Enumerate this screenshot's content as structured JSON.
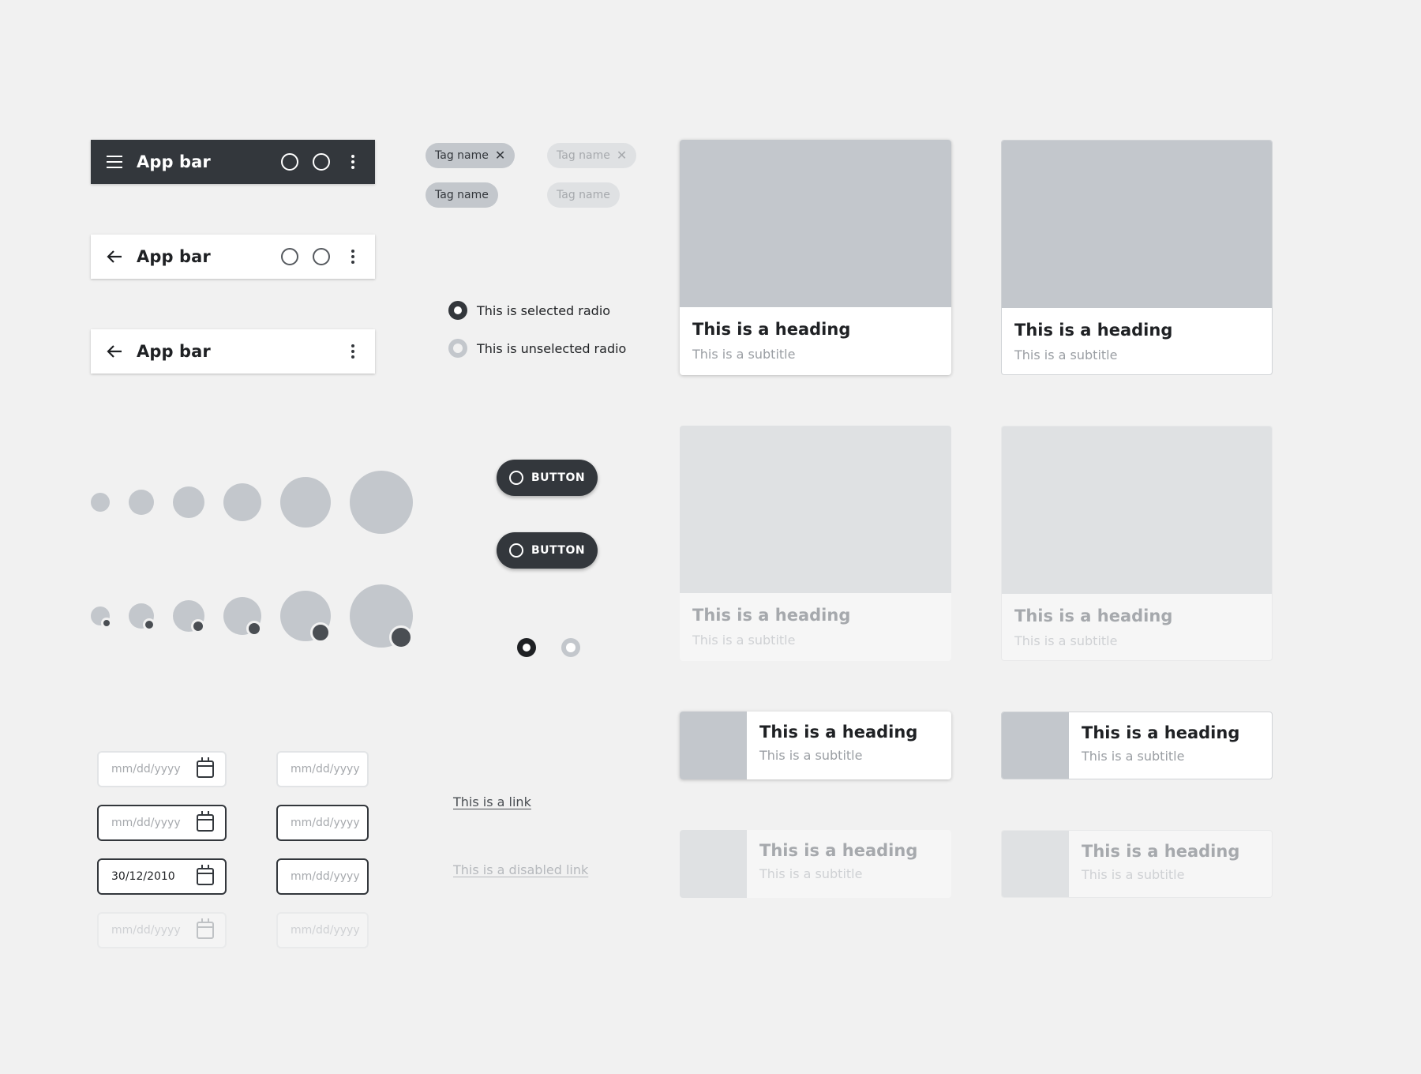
{
  "app_bars": [
    {
      "variant": "dark",
      "leading_icon": "menu-icon",
      "title": "App bar",
      "actions": [
        "circle-icon",
        "circle-icon",
        "more-vert-icon"
      ]
    },
    {
      "variant": "light",
      "leading_icon": "arrow-back-icon",
      "title": "App bar",
      "actions": [
        "circle-icon",
        "circle-icon",
        "more-vert-icon"
      ]
    },
    {
      "variant": "light",
      "leading_icon": "arrow-back-icon",
      "title": "App bar",
      "actions": [
        "more-vert-icon"
      ]
    }
  ],
  "tags": [
    {
      "label": "Tag name",
      "removable": true,
      "state": "enabled"
    },
    {
      "label": "Tag name",
      "removable": true,
      "state": "disabled"
    },
    {
      "label": "Tag name",
      "removable": false,
      "state": "enabled"
    },
    {
      "label": "Tag name",
      "removable": false,
      "state": "disabled"
    }
  ],
  "radios": [
    {
      "label": "This is selected radio",
      "selected": true
    },
    {
      "label": "This is unselected radio",
      "selected": false
    }
  ],
  "buttons": [
    {
      "label": "BUTTON",
      "icon": "circle-icon"
    },
    {
      "label": "BUTTON",
      "icon": "circle-icon"
    }
  ],
  "pagination": {
    "count": 2,
    "active_index": 0
  },
  "date_fields": {
    "placeholder": "mm/dd/yyyy",
    "filled_value": "30/12/2010",
    "icon": "calendar-icon",
    "rows": [
      "default",
      "focused",
      "filled",
      "disabled"
    ]
  },
  "links": {
    "enabled": "This is a link",
    "disabled": "This is a disabled link"
  },
  "cards": {
    "heading": "This is a heading",
    "subtitle": "This is a subtitle"
  },
  "colors": {
    "background": "#f1f1f1",
    "dark": "#33373c",
    "placeholder_gray": "#c3c7cc",
    "disabled_gray": "#dfe1e3",
    "text": "#1f2124"
  }
}
